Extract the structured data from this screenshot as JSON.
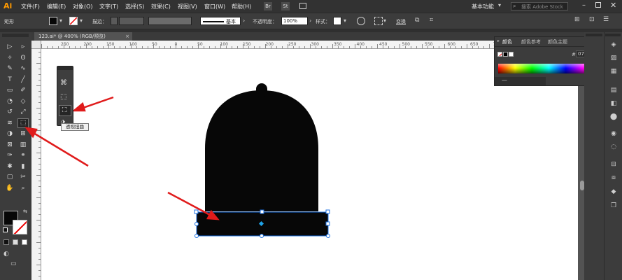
{
  "app": {
    "logo": "Ai",
    "menus": [
      "文件(F)",
      "编辑(E)",
      "对象(O)",
      "文字(T)",
      "选择(S)",
      "效果(C)",
      "视图(V)",
      "窗口(W)",
      "帮助(H)"
    ],
    "bridge_buttons": [
      "Br",
      "St"
    ],
    "workspace": "基本功能",
    "search_placeholder": "搜索 Adobe Stock"
  },
  "control_bar": {
    "selection_label": "矩形",
    "stroke_label": "描边：",
    "stroke_style": "基本",
    "opacity_label": "不透明度：",
    "opacity_value": "100%",
    "style_label": "样式：",
    "transform_label": "变换"
  },
  "document": {
    "tab_title": "123.ai* @ 400% (RGB/预览)"
  },
  "ruler": {
    "ticks": [
      "250",
      "200",
      "150",
      "100",
      "50",
      "0",
      "50",
      "100",
      "150",
      "200",
      "250",
      "300",
      "350",
      "400",
      "450",
      "500",
      "550",
      "600",
      "650",
      "700",
      "750",
      "800",
      "850"
    ]
  },
  "color_panel": {
    "tabs": [
      "颜色",
      "颜色参考",
      "颜色主题"
    ],
    "hex_value": "070707"
  },
  "tooltip": {
    "text": "透视扭曲"
  },
  "colors": {
    "shape_fill": "#070707",
    "selection": "#1a6fe0",
    "arrow": "#e01b1b",
    "ui_dark": "#3c3c3c"
  },
  "icons": {
    "toolbar": [
      "selection-tool",
      "direct-selection-tool",
      "magic-wand-tool",
      "lasso-tool",
      "pen-tool",
      "curvature-tool",
      "type-tool",
      "line-tool",
      "rectangle-tool",
      "paintbrush-tool",
      "shaper-tool",
      "eraser-tool",
      "rotate-tool",
      "scale-tool",
      "width-tool",
      "free-transform-tool",
      "shape-builder-tool",
      "perspective-grid-tool",
      "mesh-tool",
      "gradient-tool",
      "eyedropper-tool",
      "blend-tool",
      "symbol-sprayer-tool",
      "column-graph-tool",
      "artboard-tool",
      "slice-tool",
      "hand-tool",
      "zoom-tool"
    ],
    "flyout": [
      "puppet-warp-icon",
      "free-transform-icon",
      "perspective-distort-icon"
    ]
  }
}
